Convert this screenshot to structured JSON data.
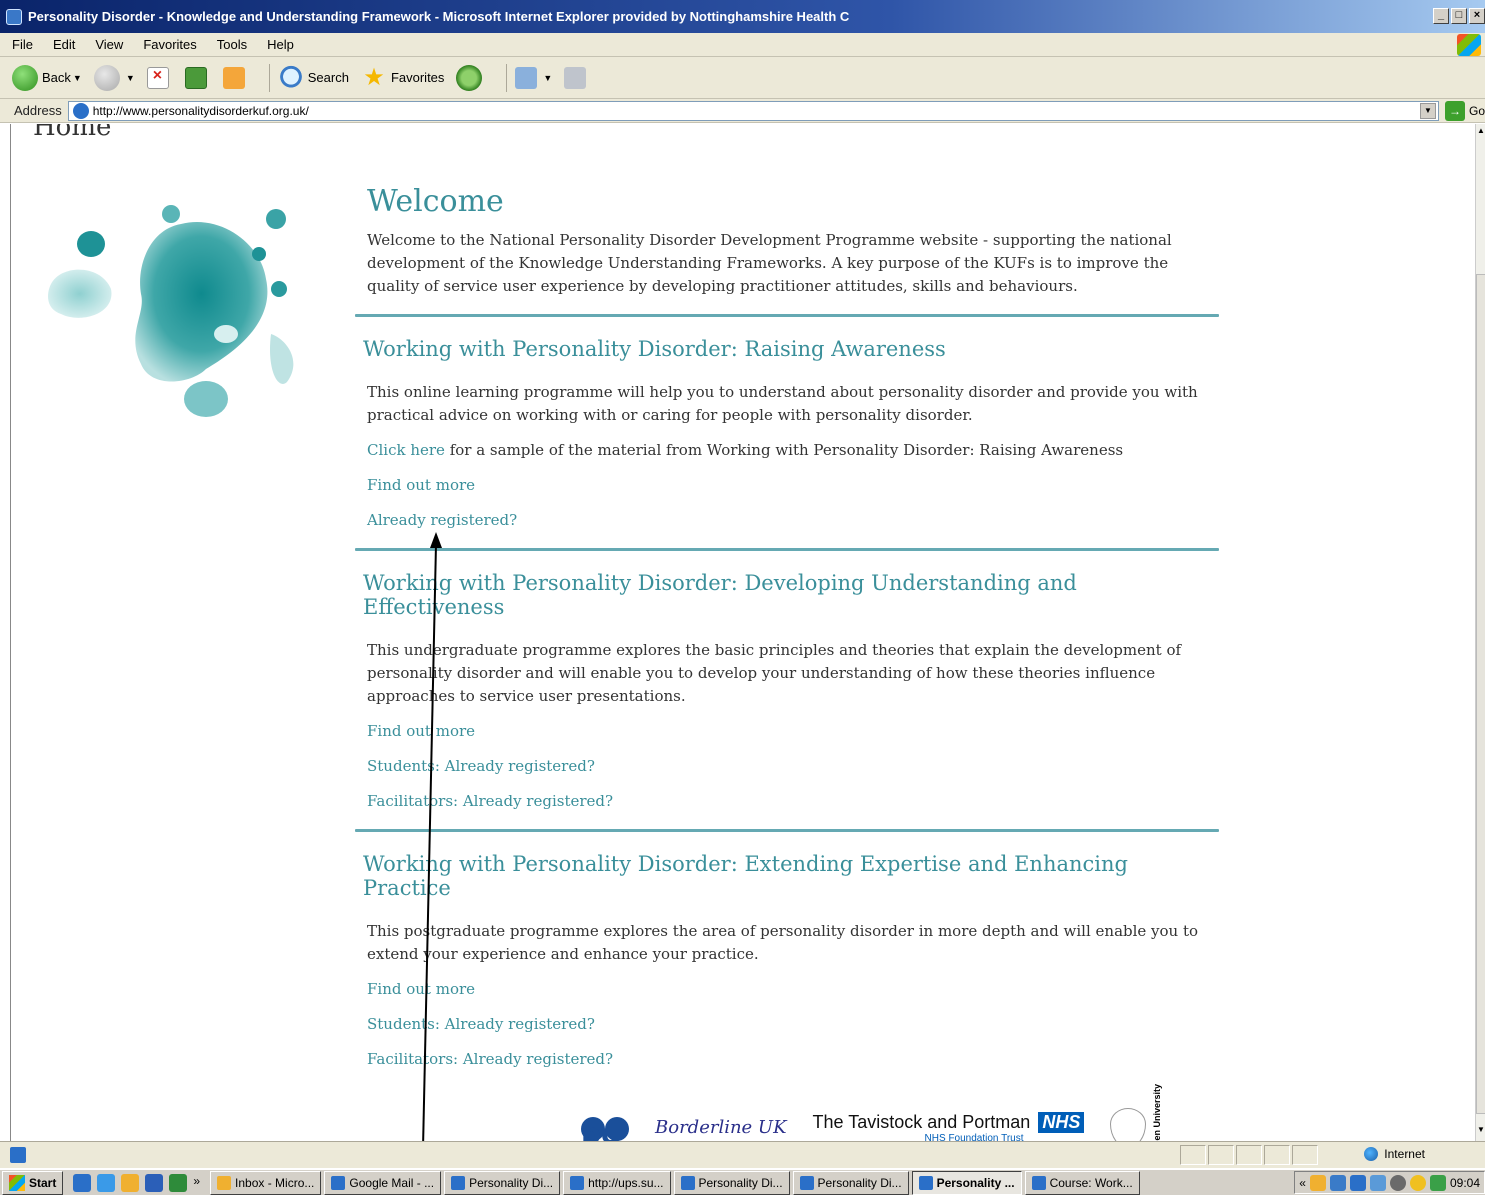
{
  "window": {
    "title": "Personality Disorder - Knowledge and Understanding Framework - Microsoft Internet Explorer provided by Nottinghamshire Health C",
    "controls": [
      "_",
      "□",
      "×"
    ]
  },
  "menubar": {
    "items": [
      "File",
      "Edit",
      "View",
      "Favorites",
      "Tools",
      "Help"
    ]
  },
  "toolbar": {
    "back_label": "Back",
    "search_label": "Search",
    "favorites_label": "Favorites"
  },
  "addressbar": {
    "label": "Address",
    "url": "http://www.personalitydisorderkuf.org.uk/",
    "go_label": "Go"
  },
  "page": {
    "home_word": "Home",
    "welcome": {
      "heading": "Welcome",
      "text": "Welcome to the National Personality Disorder Development Programme website - supporting the national development of the Knowledge Understanding Frameworks. A key purpose of the KUFs is to improve the quality of service user experience by developing practitioner attitudes, skills and behaviours."
    },
    "sections": [
      {
        "heading": "Working with Personality Disorder: Raising Awareness",
        "text": "This online learning programme will help you to understand about personality disorder and provide you with practical advice on working with or caring for people with personality disorder.",
        "click_here": "Click here",
        "click_rest": " for a sample of the material from Working with Personality Disorder: Raising Awareness",
        "links": [
          "Find out more",
          "Already registered?"
        ]
      },
      {
        "heading": "Working with Personality Disorder: Developing Understanding and Effectiveness",
        "text": "This undergraduate programme explores the basic principles and theories that explain the development of personality disorder and will enable you to develop your understanding of how these theories influence approaches to service user presentations.",
        "links": [
          "Find out more",
          "Students: Already registered?",
          "Facilitators: Already registered?"
        ]
      },
      {
        "heading": "Working with Personality Disorder: Extending Expertise and Enhancing Practice",
        "text": "This postgraduate programme explores the area of personality disorder in more depth and will enable you to extend your experience and enhance your practice.",
        "links": [
          "Find out more",
          "Students: Already registered?",
          "Facilitators: Already registered?"
        ]
      }
    ],
    "logos": {
      "pd": "pd",
      "script": "Borderline UK",
      "tavistock": "The Tavistock and Portman",
      "nhs": "NHS",
      "trust": "NHS Foundation Trust",
      "ou": "The Open University"
    }
  },
  "statusbar": {
    "zone": "Internet"
  },
  "taskbar": {
    "start_label": "Start",
    "chevron": "»",
    "tasks": [
      {
        "label": "Inbox - Micro...",
        "active": false
      },
      {
        "label": "Google Mail - ...",
        "active": false
      },
      {
        "label": "Personality Di...",
        "active": false
      },
      {
        "label": "http://ups.su...",
        "active": false
      },
      {
        "label": "Personality Di...",
        "active": false
      },
      {
        "label": "Personality Di...",
        "active": false
      },
      {
        "label": "Personality ...",
        "active": true
      },
      {
        "label": "Course: Work...",
        "active": false
      }
    ],
    "tray_chevron": "«",
    "clock": "09:04"
  },
  "colors": {
    "accent": "#3a8f9a",
    "divider": "#4a9aa6",
    "titlebar": "#0a246a"
  }
}
